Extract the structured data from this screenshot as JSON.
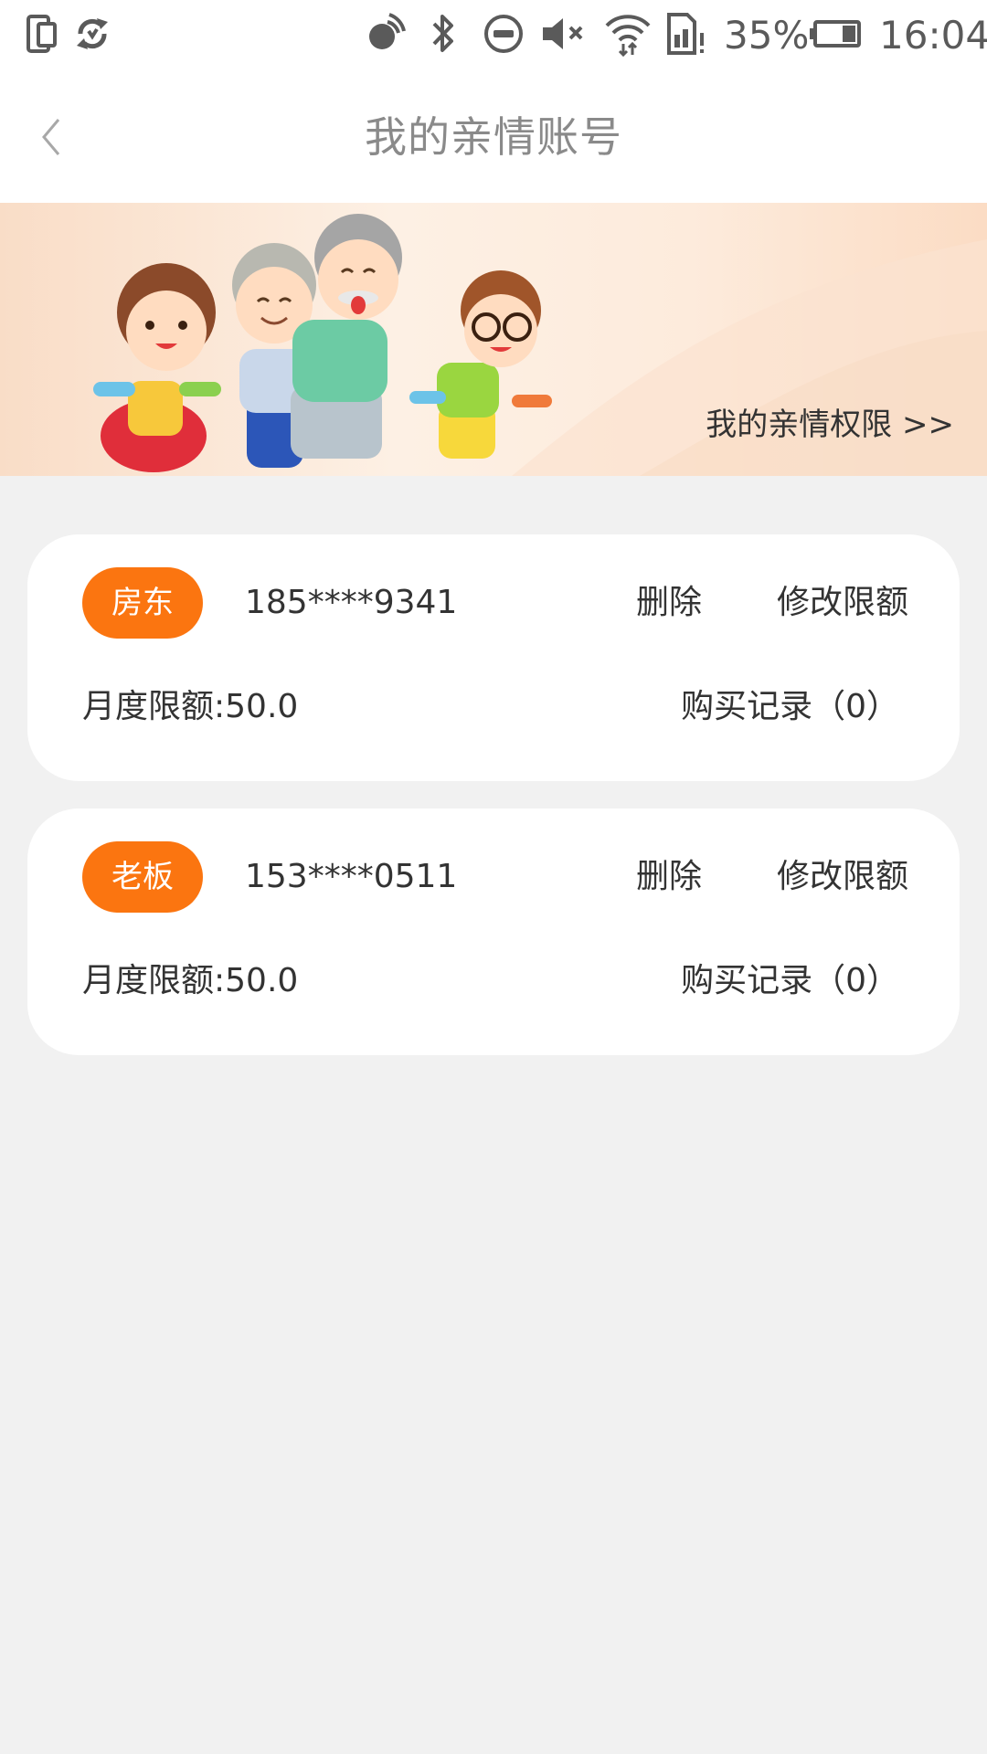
{
  "status_bar": {
    "battery_percent": "35%",
    "time": "16:04",
    "icons": [
      "phone-screen-icon",
      "sync-icon",
      "nfc-icon",
      "bluetooth-icon",
      "do-not-disturb-icon",
      "mute-icon",
      "wifi-icon",
      "sim-alert-icon",
      "battery-icon"
    ]
  },
  "nav": {
    "title": "我的亲情账号",
    "back_icon": "chevron-left-icon"
  },
  "banner": {
    "link_text": "我的亲情权限 >>",
    "illustration": "family-illustration"
  },
  "accounts": [
    {
      "tag": "房东",
      "phone": "185****9341",
      "delete_label": "删除",
      "edit_label": "修改限额",
      "limit_text": "月度限额:50.0",
      "records_text": "购买记录（0）"
    },
    {
      "tag": "老板",
      "phone": "153****0511",
      "delete_label": "删除",
      "edit_label": "修改限额",
      "limit_text": "月度限额:50.0",
      "records_text": "购买记录（0）"
    }
  ],
  "colors": {
    "accent": "#fb7510",
    "page_bg": "#f1f1f1",
    "card_bg": "#ffffff",
    "text": "#333333",
    "title": "#8a8a8a"
  }
}
